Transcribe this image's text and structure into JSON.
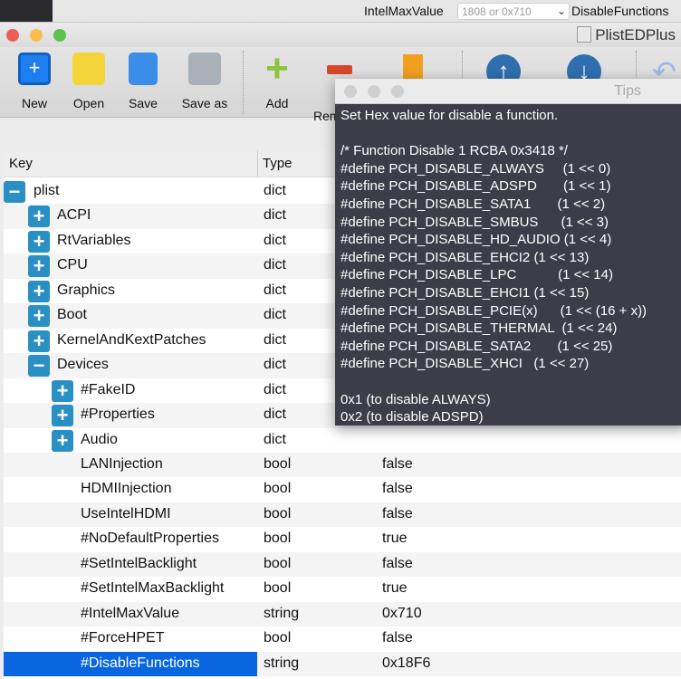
{
  "topbar": {
    "label1": "IntelMaxValue",
    "placeholder": "1808 or 0x710",
    "label2": "DisableFunctions"
  },
  "app": {
    "title": "PlistEDPlus"
  },
  "toolbar": {
    "new": "New",
    "open": "Open",
    "save": "Save",
    "save_as": "Save as",
    "add": "Add",
    "remove": "Rem"
  },
  "tree": {
    "col_key": "Key",
    "col_type": "Type",
    "rows": [
      {
        "key": "plist",
        "type": "dict",
        "value": "",
        "level": 0,
        "toggle": "minus"
      },
      {
        "key": "ACPI",
        "type": "dict",
        "value": "",
        "level": 1,
        "toggle": "plus"
      },
      {
        "key": "RtVariables",
        "type": "dict",
        "value": "",
        "level": 1,
        "toggle": "plus"
      },
      {
        "key": "CPU",
        "type": "dict",
        "value": "",
        "level": 1,
        "toggle": "plus"
      },
      {
        "key": "Graphics",
        "type": "dict",
        "value": "",
        "level": 1,
        "toggle": "plus"
      },
      {
        "key": "Boot",
        "type": "dict",
        "value": "",
        "level": 1,
        "toggle": "plus"
      },
      {
        "key": "KernelAndKextPatches",
        "type": "dict",
        "value": "",
        "level": 1,
        "toggle": "plus"
      },
      {
        "key": "Devices",
        "type": "dict",
        "value": "",
        "level": 1,
        "toggle": "minus"
      },
      {
        "key": "#FakeID",
        "type": "dict",
        "value": "",
        "level": 2,
        "toggle": "plus"
      },
      {
        "key": "#Properties",
        "type": "dict",
        "value": "",
        "level": 2,
        "toggle": "plus"
      },
      {
        "key": "Audio",
        "type": "dict",
        "value": "",
        "level": 2,
        "toggle": "plus"
      },
      {
        "key": "LANInjection",
        "type": "bool",
        "value": "false",
        "level": 3,
        "toggle": ""
      },
      {
        "key": "HDMIInjection",
        "type": "bool",
        "value": "false",
        "level": 3,
        "toggle": ""
      },
      {
        "key": "UseIntelHDMI",
        "type": "bool",
        "value": "false",
        "level": 3,
        "toggle": ""
      },
      {
        "key": "#NoDefaultProperties",
        "type": "bool",
        "value": "true",
        "level": 3,
        "toggle": ""
      },
      {
        "key": "#SetIntelBacklight",
        "type": "bool",
        "value": "false",
        "level": 3,
        "toggle": ""
      },
      {
        "key": "#SetIntelMaxBacklight",
        "type": "bool",
        "value": "true",
        "level": 3,
        "toggle": ""
      },
      {
        "key": "#IntelMaxValue",
        "type": "string",
        "value": "0x710",
        "level": 3,
        "toggle": ""
      },
      {
        "key": "#ForceHPET",
        "type": "bool",
        "value": "false",
        "level": 3,
        "toggle": ""
      },
      {
        "key": "#DisableFunctions",
        "type": "string",
        "value": "0x18F6",
        "level": 3,
        "toggle": "",
        "selected": true
      }
    ]
  },
  "tips": {
    "title": "Tips",
    "text": "Set Hex value for disable a function.\n\n/* Function Disable 1 RCBA 0x3418 */\n#define PCH_DISABLE_ALWAYS     (1 << 0)\n#define PCH_DISABLE_ADSPD       (1 << 1)\n#define PCH_DISABLE_SATA1       (1 << 2)\n#define PCH_DISABLE_SMBUS      (1 << 3)\n#define PCH_DISABLE_HD_AUDIO (1 << 4)\n#define PCH_DISABLE_EHCI2 (1 << 13)\n#define PCH_DISABLE_LPC           (1 << 14)\n#define PCH_DISABLE_EHCI1 (1 << 15)\n#define PCH_DISABLE_PCIE(x)      (1 << (16 + x))\n#define PCH_DISABLE_THERMAL  (1 << 24)\n#define PCH_DISABLE_SATA2       (1 << 25)\n#define PCH_DISABLE_XHCI   (1 << 27)\n\n0x1 (to disable ALWAYS)\n0x2 (to disable ADSPD)"
  }
}
